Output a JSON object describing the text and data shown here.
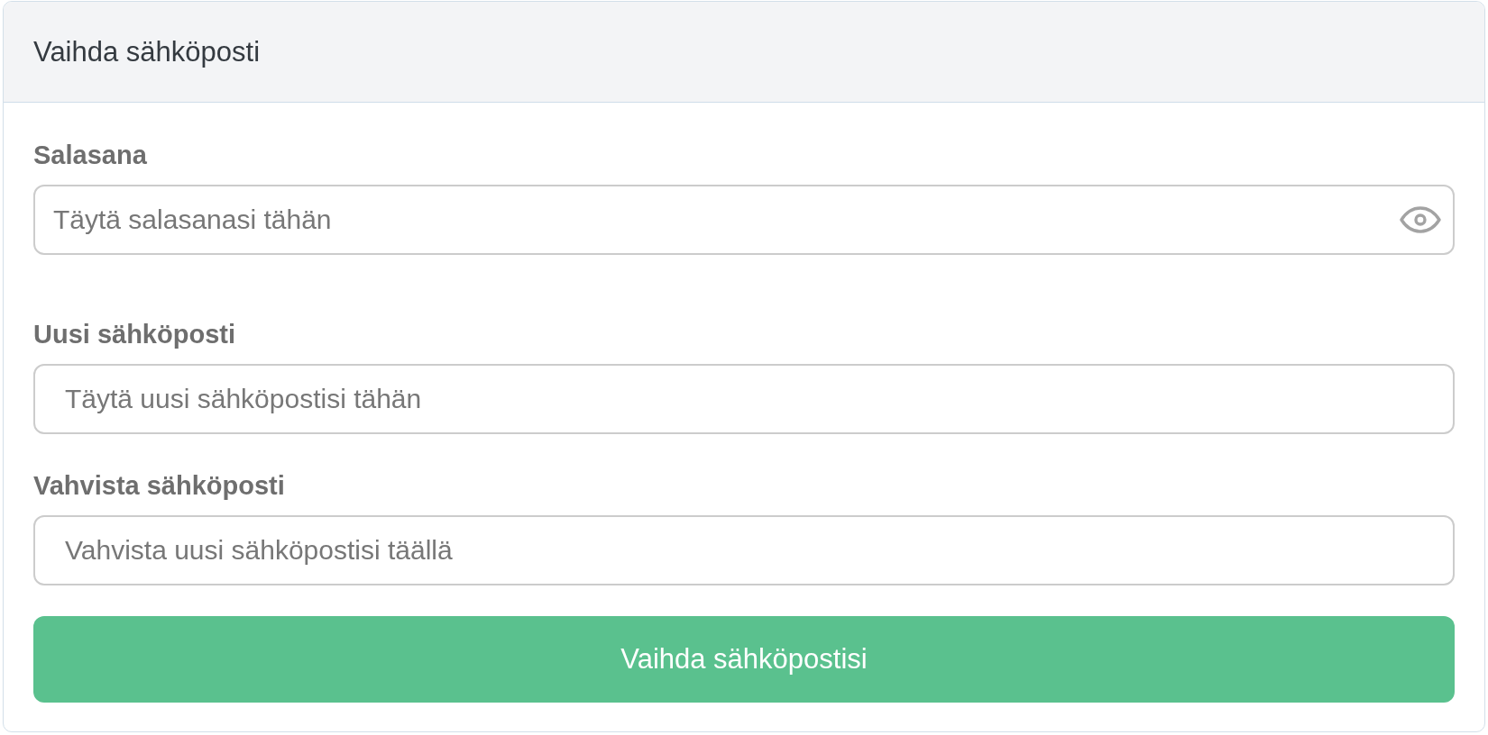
{
  "card": {
    "title": "Vaihda sähköposti"
  },
  "fields": [
    {
      "kind": "password",
      "label": "Salasana",
      "placeholder": "Täytä salasanasi tähän"
    },
    {
      "kind": "email",
      "label": "Uusi sähköposti",
      "placeholder": "Täytä uusi sähköpostisi tähän"
    },
    {
      "kind": "email",
      "label": "Vahvista sähköposti",
      "placeholder": "Vahvista uusi sähköpostisi täällä"
    }
  ],
  "submit_button": {
    "label": "Vaihda sähköpostisi"
  }
}
